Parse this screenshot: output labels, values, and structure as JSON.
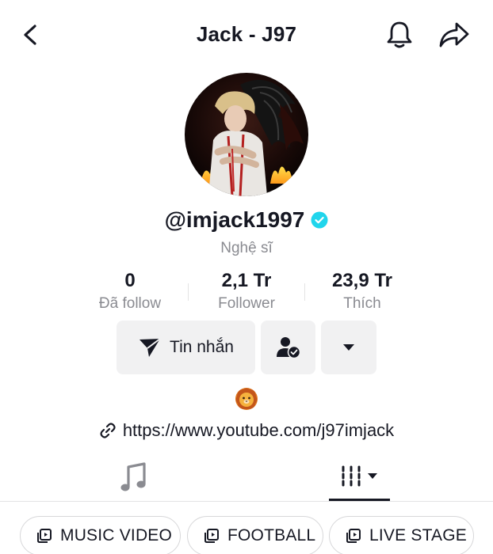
{
  "header": {
    "title": "Jack - J97",
    "icons": {
      "back": "chevron-left-icon",
      "notification": "bell-icon",
      "share": "share-arrow-icon"
    }
  },
  "profile": {
    "username": "@imjack1997",
    "verified": true,
    "category": "Nghệ sĩ",
    "avatar_description_icon": "avatar"
  },
  "stats": [
    {
      "value": "0",
      "label": "Đã follow"
    },
    {
      "value": "2,1 Tr",
      "label": "Follower"
    },
    {
      "value": "23,9 Tr",
      "label": "Thích"
    }
  ],
  "actions": {
    "message_label": "Tin nhắn",
    "message_icon": "paper-plane-icon",
    "friend_icon": "user-check-icon",
    "more_icon": "caret-down-icon"
  },
  "bio": {
    "emoji": "lion-emoji-icon",
    "link": "https://www.youtube.com/j97imjack",
    "link_icon": "link-icon"
  },
  "tabs": [
    {
      "name": "music",
      "icon": "music-note-icon",
      "active": false
    },
    {
      "name": "videos",
      "icon": "grid-dropdown-icon",
      "active": true
    }
  ],
  "playlists": [
    {
      "label": "MUSIC VIDEO",
      "icon": "playlist-icon"
    },
    {
      "label": "FOOTBALL",
      "icon": "playlist-icon"
    },
    {
      "label": "LIVE STAGE",
      "icon": "playlist-icon"
    }
  ],
  "colors": {
    "text": "#161823",
    "secondary_text": "#8a8b91",
    "button_bg": "#f1f1f2",
    "verified": "#20d5ec"
  }
}
